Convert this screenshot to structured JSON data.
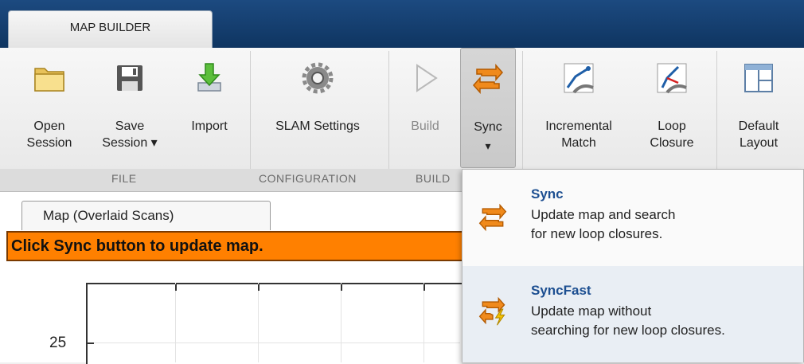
{
  "app_tab": "MAP BUILDER",
  "ribbon": {
    "open_session": "Open\nSession",
    "save_session": "Save\nSession ▾",
    "import": "Import",
    "slam_settings": "SLAM Settings",
    "build": "Build",
    "sync": "Sync",
    "sync_arrow": "▾",
    "incremental_match": "Incremental\nMatch",
    "loop_closure": "Loop\nClosure",
    "default_layout": "Default\nLayout"
  },
  "groups": {
    "file": "FILE",
    "configuration": "CONFIGURATION",
    "build": "BUILD"
  },
  "document_tab": "Map (Overlaid Scans)",
  "banner": "Click Sync button to update map.",
  "plot": {
    "ytick": "25"
  },
  "sync_menu": [
    {
      "title": "Sync",
      "desc": "Update map and search\nfor new loop closures.",
      "icon": "sync-icon"
    },
    {
      "title": "SyncFast",
      "desc": "Update map without\nsearching for new loop closures.",
      "icon": "syncfast-icon"
    }
  ],
  "colors": {
    "accent": "#ff8000",
    "ribbon_title": "#0f3561",
    "link": "#1d4f91"
  }
}
